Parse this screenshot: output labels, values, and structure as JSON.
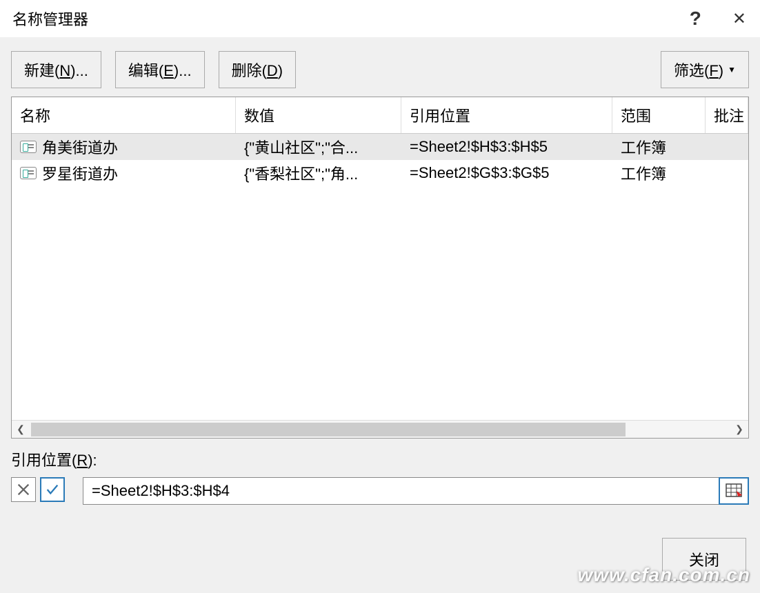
{
  "title": "名称管理器",
  "titlebar": {
    "help": "?",
    "close": "✕"
  },
  "toolbar": {
    "new_label": "新建(N)...",
    "edit_label": "编辑(E)...",
    "delete_label": "删除(D)",
    "filter_label": "筛选(F)"
  },
  "columns": {
    "name": "名称",
    "value": "数值",
    "refersto": "引用位置",
    "scope": "范围",
    "comment": "批注"
  },
  "rows": [
    {
      "name": "角美街道办",
      "value": "{\"黄山社区\";\"合...",
      "refersto": "=Sheet2!$H$3:$H$5",
      "scope": "工作簿",
      "selected": true
    },
    {
      "name": "罗星街道办",
      "value": "{\"香梨社区\";\"角...",
      "refersto": "=Sheet2!$G$3:$G$5",
      "scope": "工作簿",
      "selected": false
    }
  ],
  "refers": {
    "label": "引用位置(R):",
    "value": "=Sheet2!$H$3:$H$4"
  },
  "footer": {
    "close_label": "关闭"
  },
  "watermark": "www.cfan.com.cn"
}
